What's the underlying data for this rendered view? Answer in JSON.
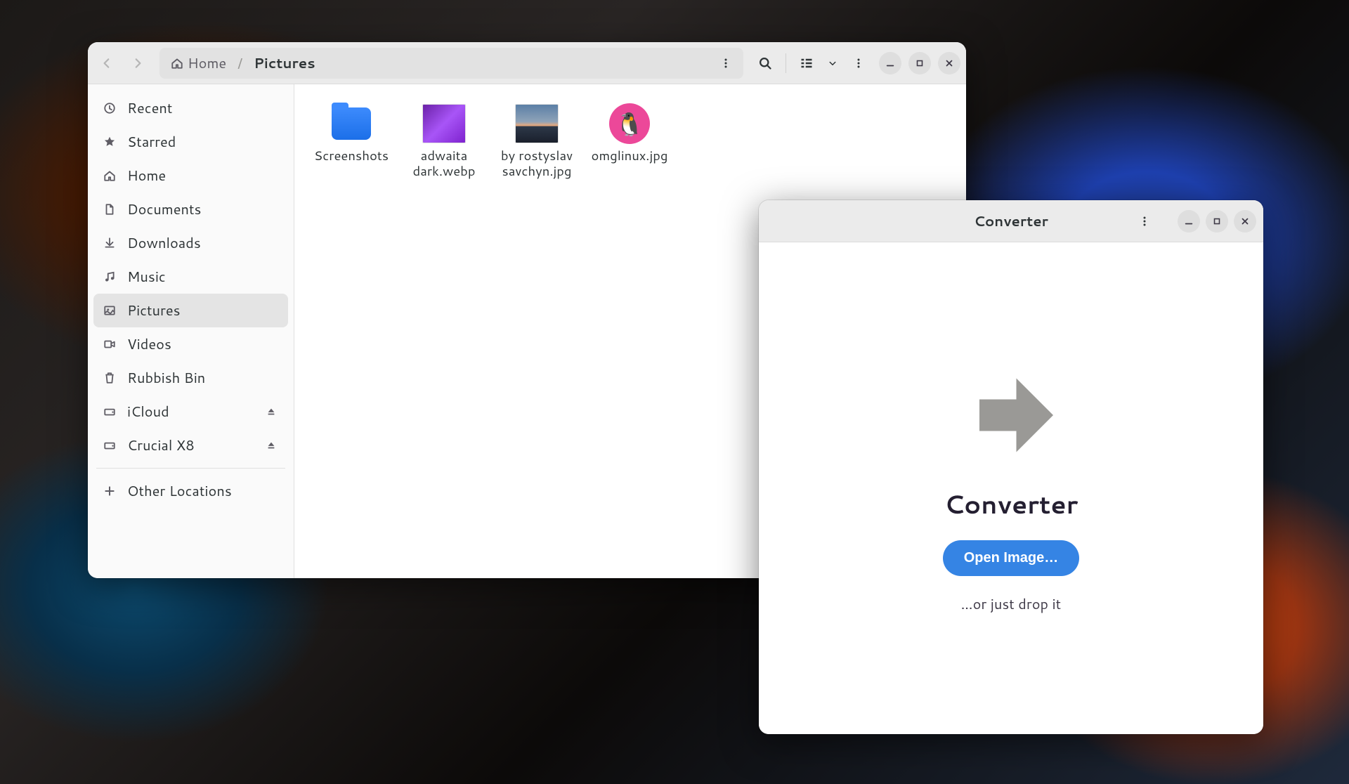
{
  "files_window": {
    "breadcrumb": {
      "home": "Home",
      "current": "Pictures"
    },
    "sidebar": {
      "items": [
        {
          "label": "Recent",
          "icon": "clock"
        },
        {
          "label": "Starred",
          "icon": "star"
        },
        {
          "label": "Home",
          "icon": "home"
        },
        {
          "label": "Documents",
          "icon": "document"
        },
        {
          "label": "Downloads",
          "icon": "download"
        },
        {
          "label": "Music",
          "icon": "music"
        },
        {
          "label": "Pictures",
          "icon": "pictures",
          "active": true
        },
        {
          "label": "Videos",
          "icon": "video"
        },
        {
          "label": "Rubbish Bin",
          "icon": "trash"
        },
        {
          "label": "iCloud",
          "icon": "drive",
          "eject": true
        },
        {
          "label": "Crucial X8",
          "icon": "drive",
          "eject": true
        }
      ],
      "other_locations": "Other Locations"
    },
    "files": [
      {
        "label": "Screenshots",
        "type": "folder"
      },
      {
        "label": "adwaita dark.webp",
        "type": "purple"
      },
      {
        "label": "by rostyslav savchyn.jpg",
        "type": "sunset"
      },
      {
        "label": "omglinux.jpg",
        "type": "linux"
      }
    ]
  },
  "converter_window": {
    "title": "Converter",
    "heading": "Converter",
    "open_button": "Open Image…",
    "drop_hint": "…or just drop it"
  }
}
